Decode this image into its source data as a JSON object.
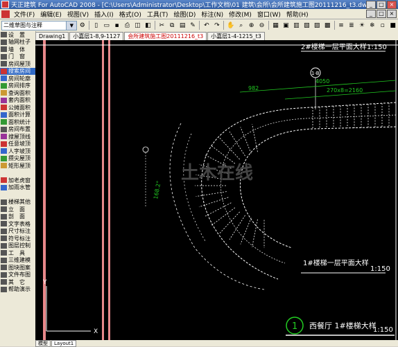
{
  "window": {
    "title": "天正建筑 For AutoCAD 2008 - [C:\\Users\\Administrator\\Desktop\\工作文档\\01 建筑\\会所\\会所建筑施工图20111216_t3.dwg]",
    "buttons": [
      "_",
      "□",
      "×"
    ]
  },
  "menu": {
    "items": [
      "文件(F)",
      "编辑(E)",
      "视图(V)",
      "插入(I)",
      "格式(O)",
      "工具(T)",
      "绘图(D)",
      "标注(N)",
      "修改(M)",
      "窗口(W)",
      "帮助(H)"
    ]
  },
  "toolbar": {
    "workspace_value": "二维草图与注释"
  },
  "tabs": [
    "Drawing1",
    "小嘉层1-8,9-1127",
    "会所建筑施工图20111216_t3",
    "小嘉层1-4-1215_t3"
  ],
  "sidebar": {
    "items": [
      {
        "label": "设　置",
        "kind": "header"
      },
      {
        "label": "轴网柱子",
        "kind": "header"
      },
      {
        "label": "墙　体",
        "kind": "header"
      },
      {
        "label": "门　窗",
        "kind": "header"
      },
      {
        "label": "房间屋顶",
        "kind": "header"
      },
      {
        "label": "搜索房间",
        "kind": "sel"
      },
      {
        "label": "房间轮廓",
        "kind": "item"
      },
      {
        "label": "房间排序",
        "kind": "item"
      },
      {
        "label": "查询面积",
        "kind": "item"
      },
      {
        "label": "套内面积",
        "kind": "item"
      },
      {
        "label": "公摊面积",
        "kind": "item"
      },
      {
        "label": "面积计算",
        "kind": "item"
      },
      {
        "label": "面积统计",
        "kind": "item"
      },
      {
        "label": "房间布置",
        "kind": "header"
      },
      {
        "label": "搜屋顶线",
        "kind": "item"
      },
      {
        "label": "任意坡顶",
        "kind": "item"
      },
      {
        "label": "人字坡顶",
        "kind": "item"
      },
      {
        "label": "攒尖屋顶",
        "kind": "item"
      },
      {
        "label": "矩形屋顶",
        "kind": "item"
      },
      {
        "label": "",
        "kind": "gap"
      },
      {
        "label": "加老虎窗",
        "kind": "item"
      },
      {
        "label": "加雨水管",
        "kind": "item"
      },
      {
        "label": "",
        "kind": "gap"
      },
      {
        "label": "楼梯其他",
        "kind": "header"
      },
      {
        "label": "立　面",
        "kind": "header"
      },
      {
        "label": "剖　面",
        "kind": "header"
      },
      {
        "label": "文字表格",
        "kind": "header"
      },
      {
        "label": "尺寸标注",
        "kind": "header"
      },
      {
        "label": "符号标注",
        "kind": "header"
      },
      {
        "label": "图层控制",
        "kind": "header"
      },
      {
        "label": "工　具",
        "kind": "header"
      },
      {
        "label": "三维建模",
        "kind": "header"
      },
      {
        "label": "图块图案",
        "kind": "header"
      },
      {
        "label": "文件布图",
        "kind": "header"
      },
      {
        "label": "其　它",
        "kind": "header"
      },
      {
        "label": "帮助演示",
        "kind": "header"
      }
    ]
  },
  "drawing": {
    "title_top": "2#楼梯一层平面大样",
    "scale_top": "1:150",
    "axis_tag": "1-B",
    "dim_4050": "4050",
    "dim_982": "982",
    "dim_270": "270x8=2160",
    "dim_left": "168.2°",
    "title_mid": "1#楼梯一层平面大样",
    "scale_mid": "1:150",
    "circle_label": "1",
    "bottom_caption": "西餐厅 1#楼梯大样",
    "scale_bottom": "1:150",
    "watermark": "土木在线",
    "axis_y": "Y",
    "axis_x": "X"
  },
  "status": {
    "tabs": [
      "模型",
      "Layout1"
    ]
  },
  "colors": {
    "canvas": "#000000",
    "pink_line": "#e8888a",
    "geometry": "#ffffff",
    "dims": "#22cc22"
  }
}
